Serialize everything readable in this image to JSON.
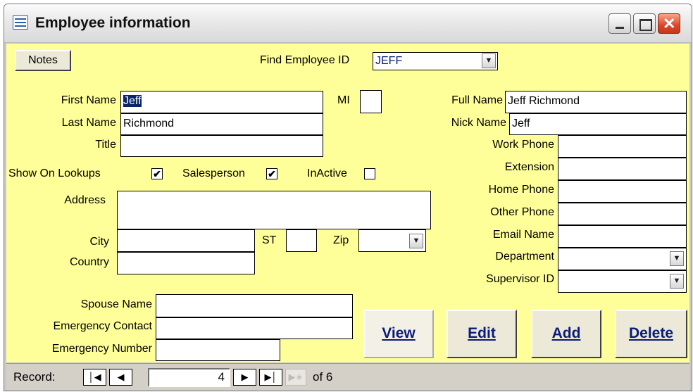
{
  "window": {
    "title": "Employee information"
  },
  "toolbar": {
    "notes_label": "Notes"
  },
  "find": {
    "label": "Find Employee ID",
    "value": "JEFF"
  },
  "fields": {
    "first_name": {
      "label": "First Name",
      "value": "Jeff"
    },
    "last_name": {
      "label": "Last Name",
      "value": "Richmond"
    },
    "title": {
      "label": "Title",
      "value": ""
    },
    "mi": {
      "label": "MI",
      "value": ""
    },
    "full_name": {
      "label": "Full Name",
      "value": "Jeff Richmond"
    },
    "nick_name": {
      "label": "Nick Name",
      "value": "Jeff"
    },
    "work_phone": {
      "label": "Work Phone",
      "value": ""
    },
    "extension": {
      "label": "Extension",
      "value": ""
    },
    "home_phone": {
      "label": "Home Phone",
      "value": ""
    },
    "other_phone": {
      "label": "Other Phone",
      "value": ""
    },
    "email_name": {
      "label": "Email Name",
      "value": ""
    },
    "department": {
      "label": "Department",
      "value": ""
    },
    "supervisor_id": {
      "label": "Supervisor ID",
      "value": ""
    },
    "address": {
      "label": "Address",
      "value": ""
    },
    "city": {
      "label": "City",
      "value": ""
    },
    "st": {
      "label": "ST",
      "value": ""
    },
    "zip": {
      "label": "Zip",
      "value": ""
    },
    "country": {
      "label": "Country",
      "value": ""
    },
    "spouse_name": {
      "label": "Spouse Name",
      "value": ""
    },
    "emergency_contact": {
      "label": "Emergency Contact",
      "value": ""
    },
    "emergency_number": {
      "label": "Emergency Number",
      "value": ""
    }
  },
  "checkboxes": {
    "show_on_lookups": {
      "label": "Show On Lookups",
      "checked": true,
      "mark": "✔"
    },
    "salesperson": {
      "label": "Salesperson",
      "checked": true,
      "mark": "✔"
    },
    "inactive": {
      "label": "InActive",
      "checked": false,
      "mark": ""
    }
  },
  "buttons": {
    "view": "View",
    "edit": "Edit",
    "add": "Add",
    "delete": "Delete"
  },
  "record_nav": {
    "label": "Record:",
    "current": "4",
    "of_label": "of 6"
  },
  "colors": {
    "form_bg": "#ffff99",
    "selection": "#0a246a",
    "button_text": "#0a1a7a"
  },
  "icons": [
    "form-icon",
    "minimize-icon",
    "maximize-icon",
    "close-icon",
    "dropdown-arrow-icon",
    "first-record-icon",
    "previous-record-icon",
    "next-record-icon",
    "last-record-icon",
    "new-record-icon"
  ]
}
